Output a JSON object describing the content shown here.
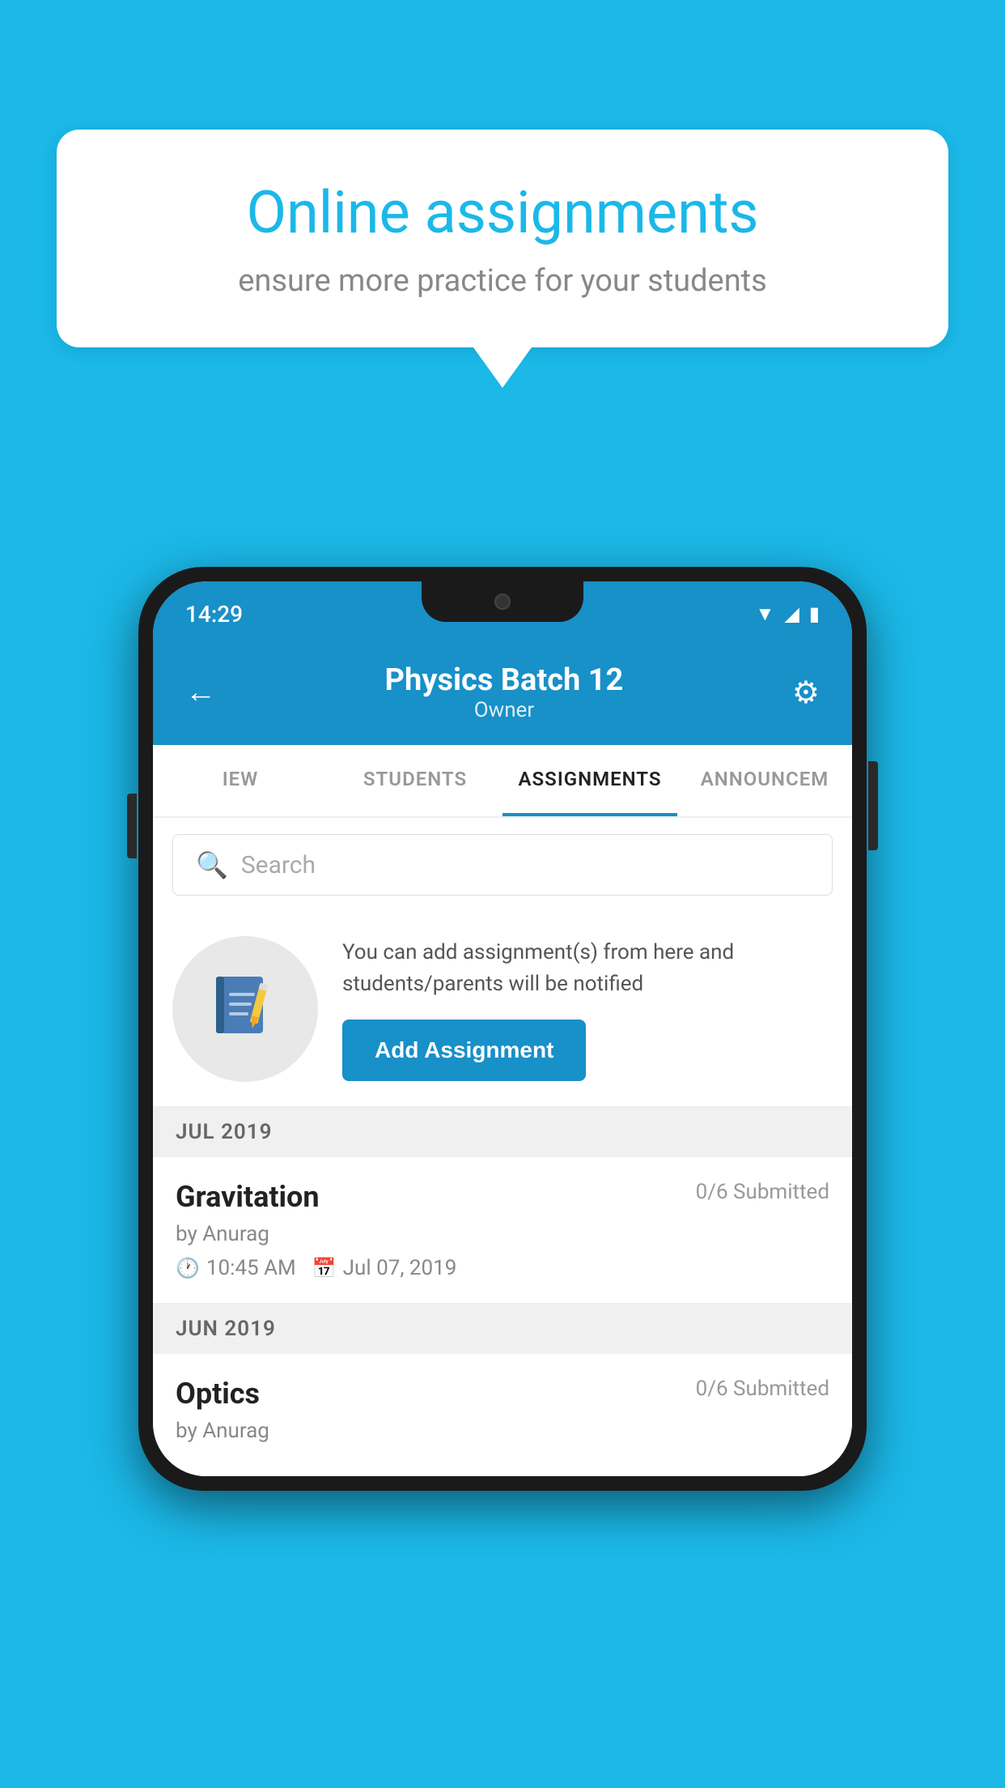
{
  "background_color": "#1bb8e8",
  "speech_bubble": {
    "title": "Online assignments",
    "subtitle": "ensure more practice for your students"
  },
  "status_bar": {
    "time": "14:29",
    "signal_icon": "▲",
    "wifi_icon": "▼",
    "battery_icon": "▮"
  },
  "header": {
    "title": "Physics Batch 12",
    "subtitle": "Owner",
    "back_label": "←",
    "settings_label": "⚙"
  },
  "tabs": [
    {
      "label": "IEW",
      "active": false
    },
    {
      "label": "STUDENTS",
      "active": false
    },
    {
      "label": "ASSIGNMENTS",
      "active": true
    },
    {
      "label": "ANNOUNCEM",
      "active": false
    }
  ],
  "search": {
    "placeholder": "Search"
  },
  "add_assignment_section": {
    "description_text": "You can add assignment(s) from here and students/parents will be notified",
    "button_label": "Add Assignment"
  },
  "assignment_groups": [
    {
      "month_label": "JUL 2019",
      "assignments": [
        {
          "name": "Gravitation",
          "submitted": "0/6 Submitted",
          "by": "by Anurag",
          "time": "10:45 AM",
          "date": "Jul 07, 2019"
        }
      ]
    },
    {
      "month_label": "JUN 2019",
      "assignments": [
        {
          "name": "Optics",
          "submitted": "0/6 Submitted",
          "by": "by Anurag",
          "time": "",
          "date": ""
        }
      ]
    }
  ]
}
